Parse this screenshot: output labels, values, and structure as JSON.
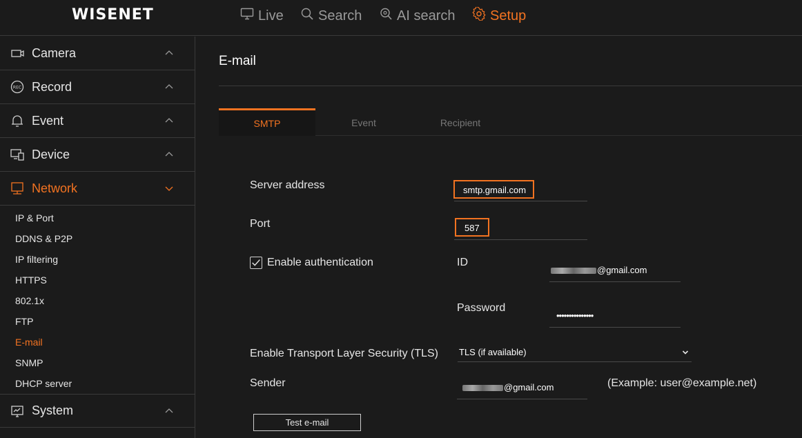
{
  "brand": "WISENET",
  "topnav": [
    {
      "label": "Live"
    },
    {
      "label": "Search"
    },
    {
      "label": "AI search"
    },
    {
      "label": "Setup"
    }
  ],
  "accent": "#f37321",
  "sidebar": {
    "sections": [
      {
        "label": "Camera"
      },
      {
        "label": "Record"
      },
      {
        "label": "Event"
      },
      {
        "label": "Device"
      },
      {
        "label": "Network"
      },
      {
        "label": "System"
      }
    ],
    "network_items": [
      "IP & Port",
      "DDNS & P2P",
      "IP filtering",
      "HTTPS",
      "802.1x",
      "FTP",
      "E-mail",
      "SNMP",
      "DHCP server"
    ]
  },
  "page": {
    "title": "E-mail",
    "tabs": [
      "SMTP",
      "Event",
      "Recipient"
    ]
  },
  "form": {
    "server_address_label": "Server address",
    "server_address_value": "smtp.gmail.com",
    "port_label": "Port",
    "port_value": "587",
    "auth_label": "Enable authentication",
    "id_label": "ID",
    "id_value_suffix": "@gmail.com",
    "password_label": "Password",
    "password_value": "•••••••••••••••",
    "tls_label": "Enable Transport Layer Security (TLS)",
    "tls_value": "TLS (if available)",
    "sender_label": "Sender",
    "sender_value_suffix": "@gmail.com",
    "sender_example": "(Example: user@example.net)",
    "test_button": "Test e-mail"
  }
}
